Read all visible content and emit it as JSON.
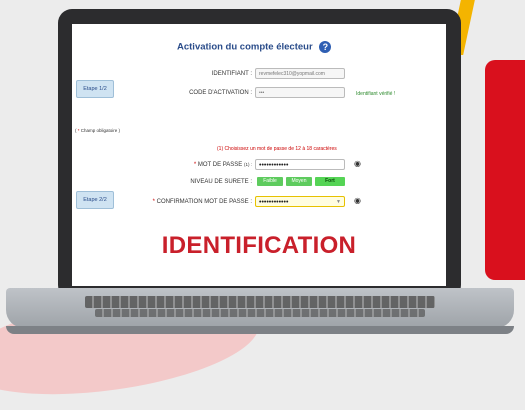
{
  "page": {
    "title": "Activation du compte électeur",
    "help_icon": "question-circle-icon"
  },
  "steps": {
    "step1": "Etape 1/2",
    "step2": "Etape 2/2"
  },
  "form": {
    "identifiant_label": "IDENTIFIANT :",
    "identifiant_value": "revmefelec310@yopmail.com",
    "code_label": "CODE D'ACTIVATION :",
    "code_value": "•••",
    "verified_text": "Identifiant vérifié !",
    "mandatory_note": "Champ obligatoire )",
    "mandatory_prefix": "( ",
    "password_hint": "(1) Choisissez un mot de passe de 12 à 18 caractères",
    "password_label": "MOT DE PASSE",
    "password_label_suffix": "(1) :",
    "password_value": "••••••••••••",
    "strength_label": "NIVEAU DE SURETE :",
    "strength_levels": [
      "Faible",
      "Moyen",
      "Fort"
    ],
    "confirm_label": "CONFIRMATION MOT DE PASSE :",
    "confirm_value": "••••••••••••",
    "eye_icon": "eye-icon"
  },
  "banner": {
    "text": "IDENTIFICATION"
  },
  "colors": {
    "accent": "#2a4c8a",
    "banner_red": "#c9202b",
    "verified_green": "#2e8b2e"
  }
}
